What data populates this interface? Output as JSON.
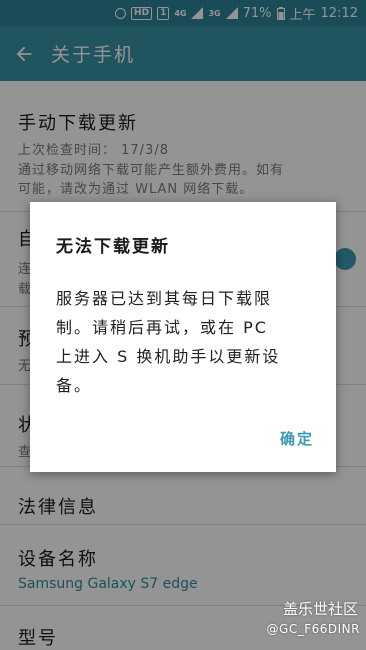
{
  "status_bar": {
    "hd": "HD",
    "sim": "1",
    "net1": "4G",
    "net2": "3G",
    "battery": "71%",
    "ampm": "上午",
    "time": "12:12"
  },
  "appbar": {
    "title": "关于手机"
  },
  "list": {
    "manual_update": {
      "title": "手动下载更新",
      "last_check": "上次检查时间： 17/3/8",
      "note_line1": "通过移动网络下载可能产生额外费用。如有",
      "note_line2": "可能，请改为通过 WLAN 网络下载。"
    },
    "auto_update": {
      "title_partial": "自",
      "sub1_partial": "连",
      "sub2_partial": "载"
    },
    "scheduled": {
      "title_partial": "预",
      "sub_partial": "无"
    },
    "status": {
      "title_partial": "状",
      "sub_partial": "查"
    },
    "legal": {
      "title": "法律信息"
    },
    "device_name": {
      "title": "设备名称",
      "value": "Samsung Galaxy S7 edge"
    },
    "model": {
      "title": "型号"
    }
  },
  "dialog": {
    "title": "无法下载更新",
    "body_line1": "服务器已达到其每日下载限",
    "body_line2": "制。请稍后再试，或在 PC",
    "body_line3": "上进入 S 换机助手以更新设",
    "body_line4": "备。",
    "ok_label": "确定"
  },
  "watermark": {
    "line1": "盖乐世社区",
    "line2": "@GC_F66DINR"
  }
}
